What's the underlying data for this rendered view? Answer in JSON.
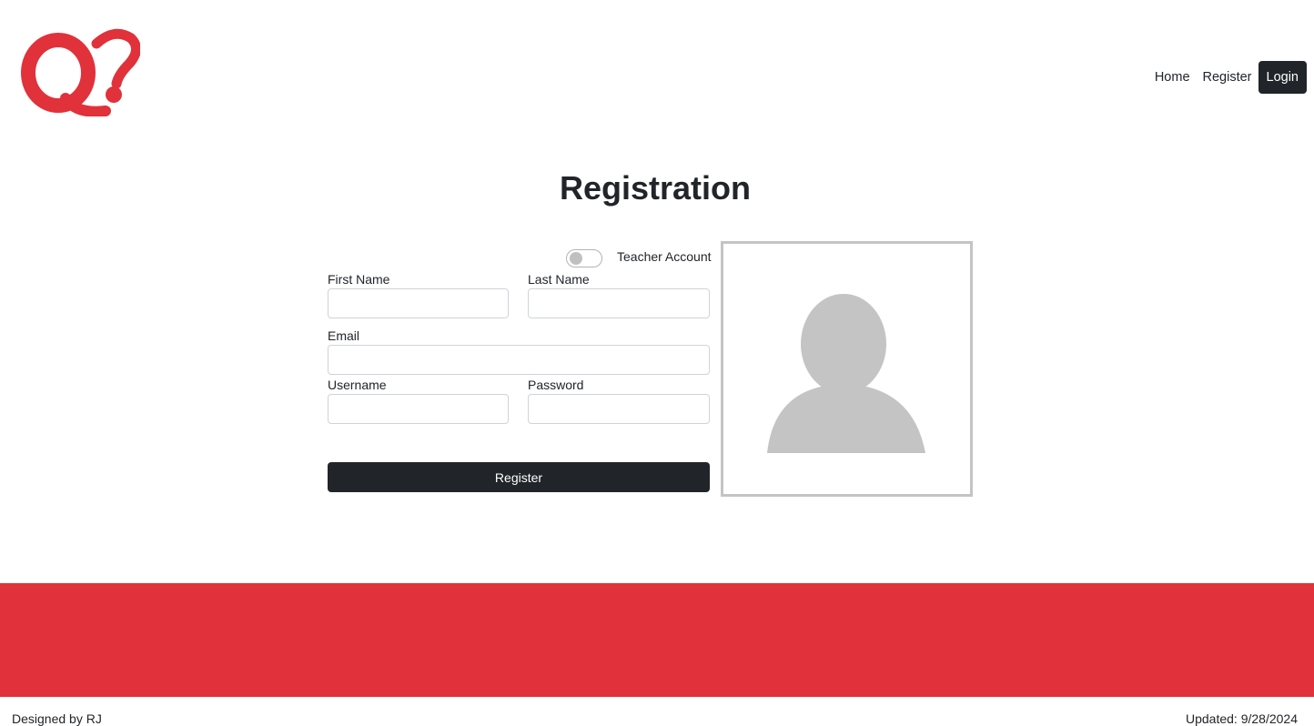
{
  "brand": {
    "logo_text": "Q?",
    "logo_icon": "logo-q-question",
    "accent_color": "#e1313a"
  },
  "nav": {
    "items": [
      {
        "label": "Home"
      },
      {
        "label": "Register"
      }
    ],
    "login_label": "Login"
  },
  "page": {
    "title": "Registration"
  },
  "form": {
    "teacher_toggle": {
      "label": "Teacher Account",
      "checked": false
    },
    "first_name": {
      "label": "First Name",
      "value": ""
    },
    "last_name": {
      "label": "Last Name",
      "value": ""
    },
    "email": {
      "label": "Email",
      "value": ""
    },
    "username": {
      "label": "Username",
      "value": ""
    },
    "password": {
      "label": "Password",
      "value": ""
    },
    "submit_label": "Register"
  },
  "avatar": {
    "icon": "user-placeholder-icon"
  },
  "footer": {
    "designed_by": "Designed by RJ",
    "updated": "Updated: 9/28/2024"
  }
}
